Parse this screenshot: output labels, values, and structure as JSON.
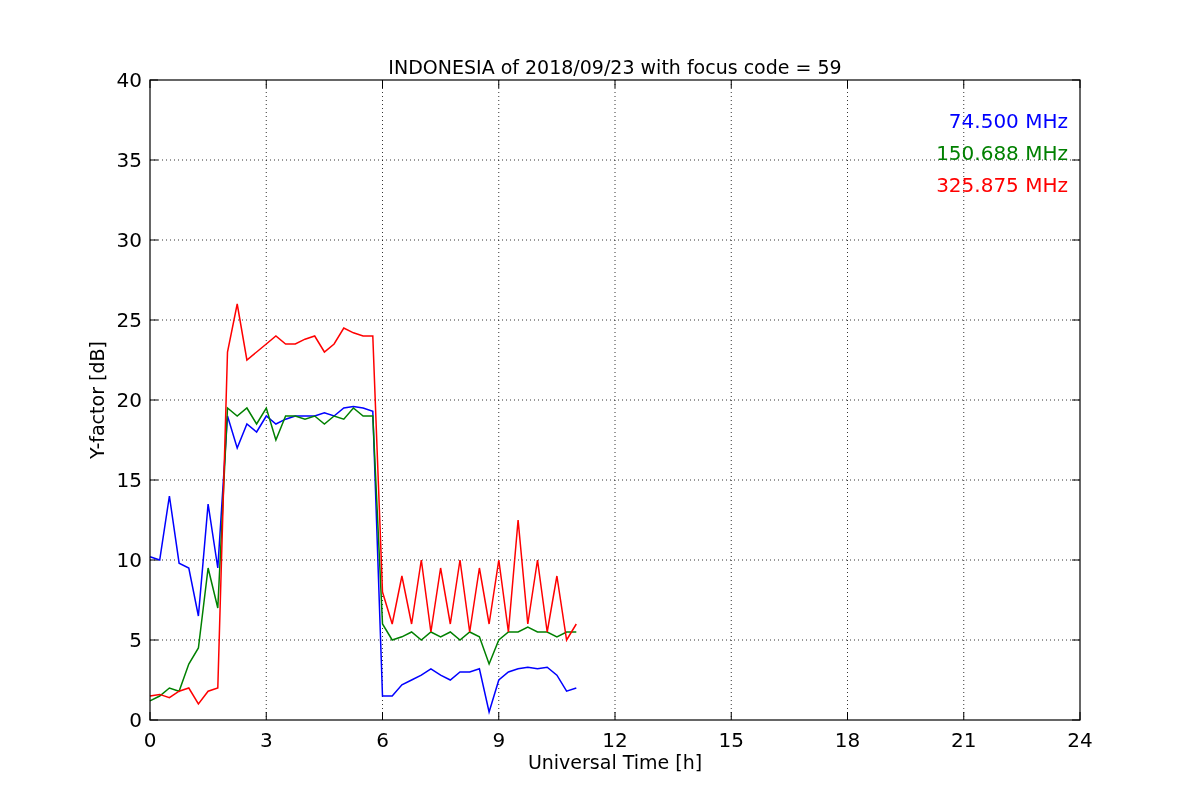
{
  "chart_data": {
    "type": "line",
    "title": "INDONESIA of 2018/09/23 with focus code = 59",
    "xlabel": "Universal Time [h]",
    "ylabel": "Y-factor [dB]",
    "x": [
      0,
      0.25,
      0.5,
      0.75,
      1,
      1.25,
      1.5,
      1.75,
      2,
      2.25,
      2.5,
      2.75,
      3,
      3.25,
      3.5,
      3.75,
      4,
      4.25,
      4.5,
      4.75,
      5,
      5.25,
      5.5,
      5.75,
      6,
      6.25,
      6.5,
      6.75,
      7,
      7.25,
      7.5,
      7.75,
      8,
      8.25,
      8.5,
      8.75,
      9,
      9.25,
      9.5,
      9.75,
      10,
      10.25,
      10.5,
      10.75,
      11
    ],
    "series": [
      {
        "name": "74.500 MHz",
        "color": "#0000ff",
        "values": [
          10.2,
          10.0,
          14.0,
          9.8,
          9.5,
          6.5,
          13.5,
          9.5,
          19.0,
          17.0,
          18.5,
          18.0,
          19.0,
          18.5,
          18.8,
          19.0,
          19.0,
          19.0,
          19.2,
          19.0,
          19.5,
          19.6,
          19.5,
          19.3,
          1.5,
          1.5,
          2.2,
          2.5,
          2.8,
          3.2,
          2.8,
          2.5,
          3.0,
          3.0,
          3.2,
          0.5,
          2.5,
          3.0,
          3.2,
          3.3,
          3.2,
          3.3,
          2.8,
          1.8,
          2.0
        ]
      },
      {
        "name": "150.688 MHz",
        "color": "#008000",
        "values": [
          1.2,
          1.5,
          2.0,
          1.8,
          3.5,
          4.5,
          9.5,
          7.0,
          19.5,
          19.0,
          19.5,
          18.5,
          19.5,
          17.5,
          19.0,
          19.0,
          18.8,
          19.0,
          18.5,
          19.0,
          18.8,
          19.5,
          19.0,
          19.0,
          6.0,
          5.0,
          5.2,
          5.5,
          5.0,
          5.5,
          5.2,
          5.5,
          5.0,
          5.5,
          5.2,
          3.5,
          5.0,
          5.5,
          5.5,
          5.8,
          5.5,
          5.5,
          5.2,
          5.5,
          5.5
        ]
      },
      {
        "name": "325.875 MHz",
        "color": "#ff0000",
        "values": [
          1.5,
          1.6,
          1.4,
          1.8,
          2.0,
          1.0,
          1.8,
          2.0,
          23.0,
          26.0,
          22.5,
          23.0,
          23.5,
          24.0,
          23.5,
          23.5,
          23.8,
          24.0,
          23.0,
          23.5,
          24.5,
          24.2,
          24.0,
          24.0,
          8.0,
          6.0,
          9.0,
          6.0,
          10.0,
          5.5,
          9.5,
          6.0,
          10.0,
          5.5,
          9.5,
          6.0,
          10.0,
          5.5,
          12.5,
          6.0,
          10.0,
          5.5,
          9.0,
          5.0,
          6.0
        ]
      }
    ],
    "grid": true,
    "xlim": [
      0,
      24
    ],
    "ylim": [
      0,
      40
    ],
    "xticks": [
      0,
      3,
      6,
      9,
      12,
      15,
      18,
      21,
      24
    ],
    "yticks": [
      0,
      5,
      10,
      15,
      20,
      25,
      30,
      35,
      40
    ]
  }
}
